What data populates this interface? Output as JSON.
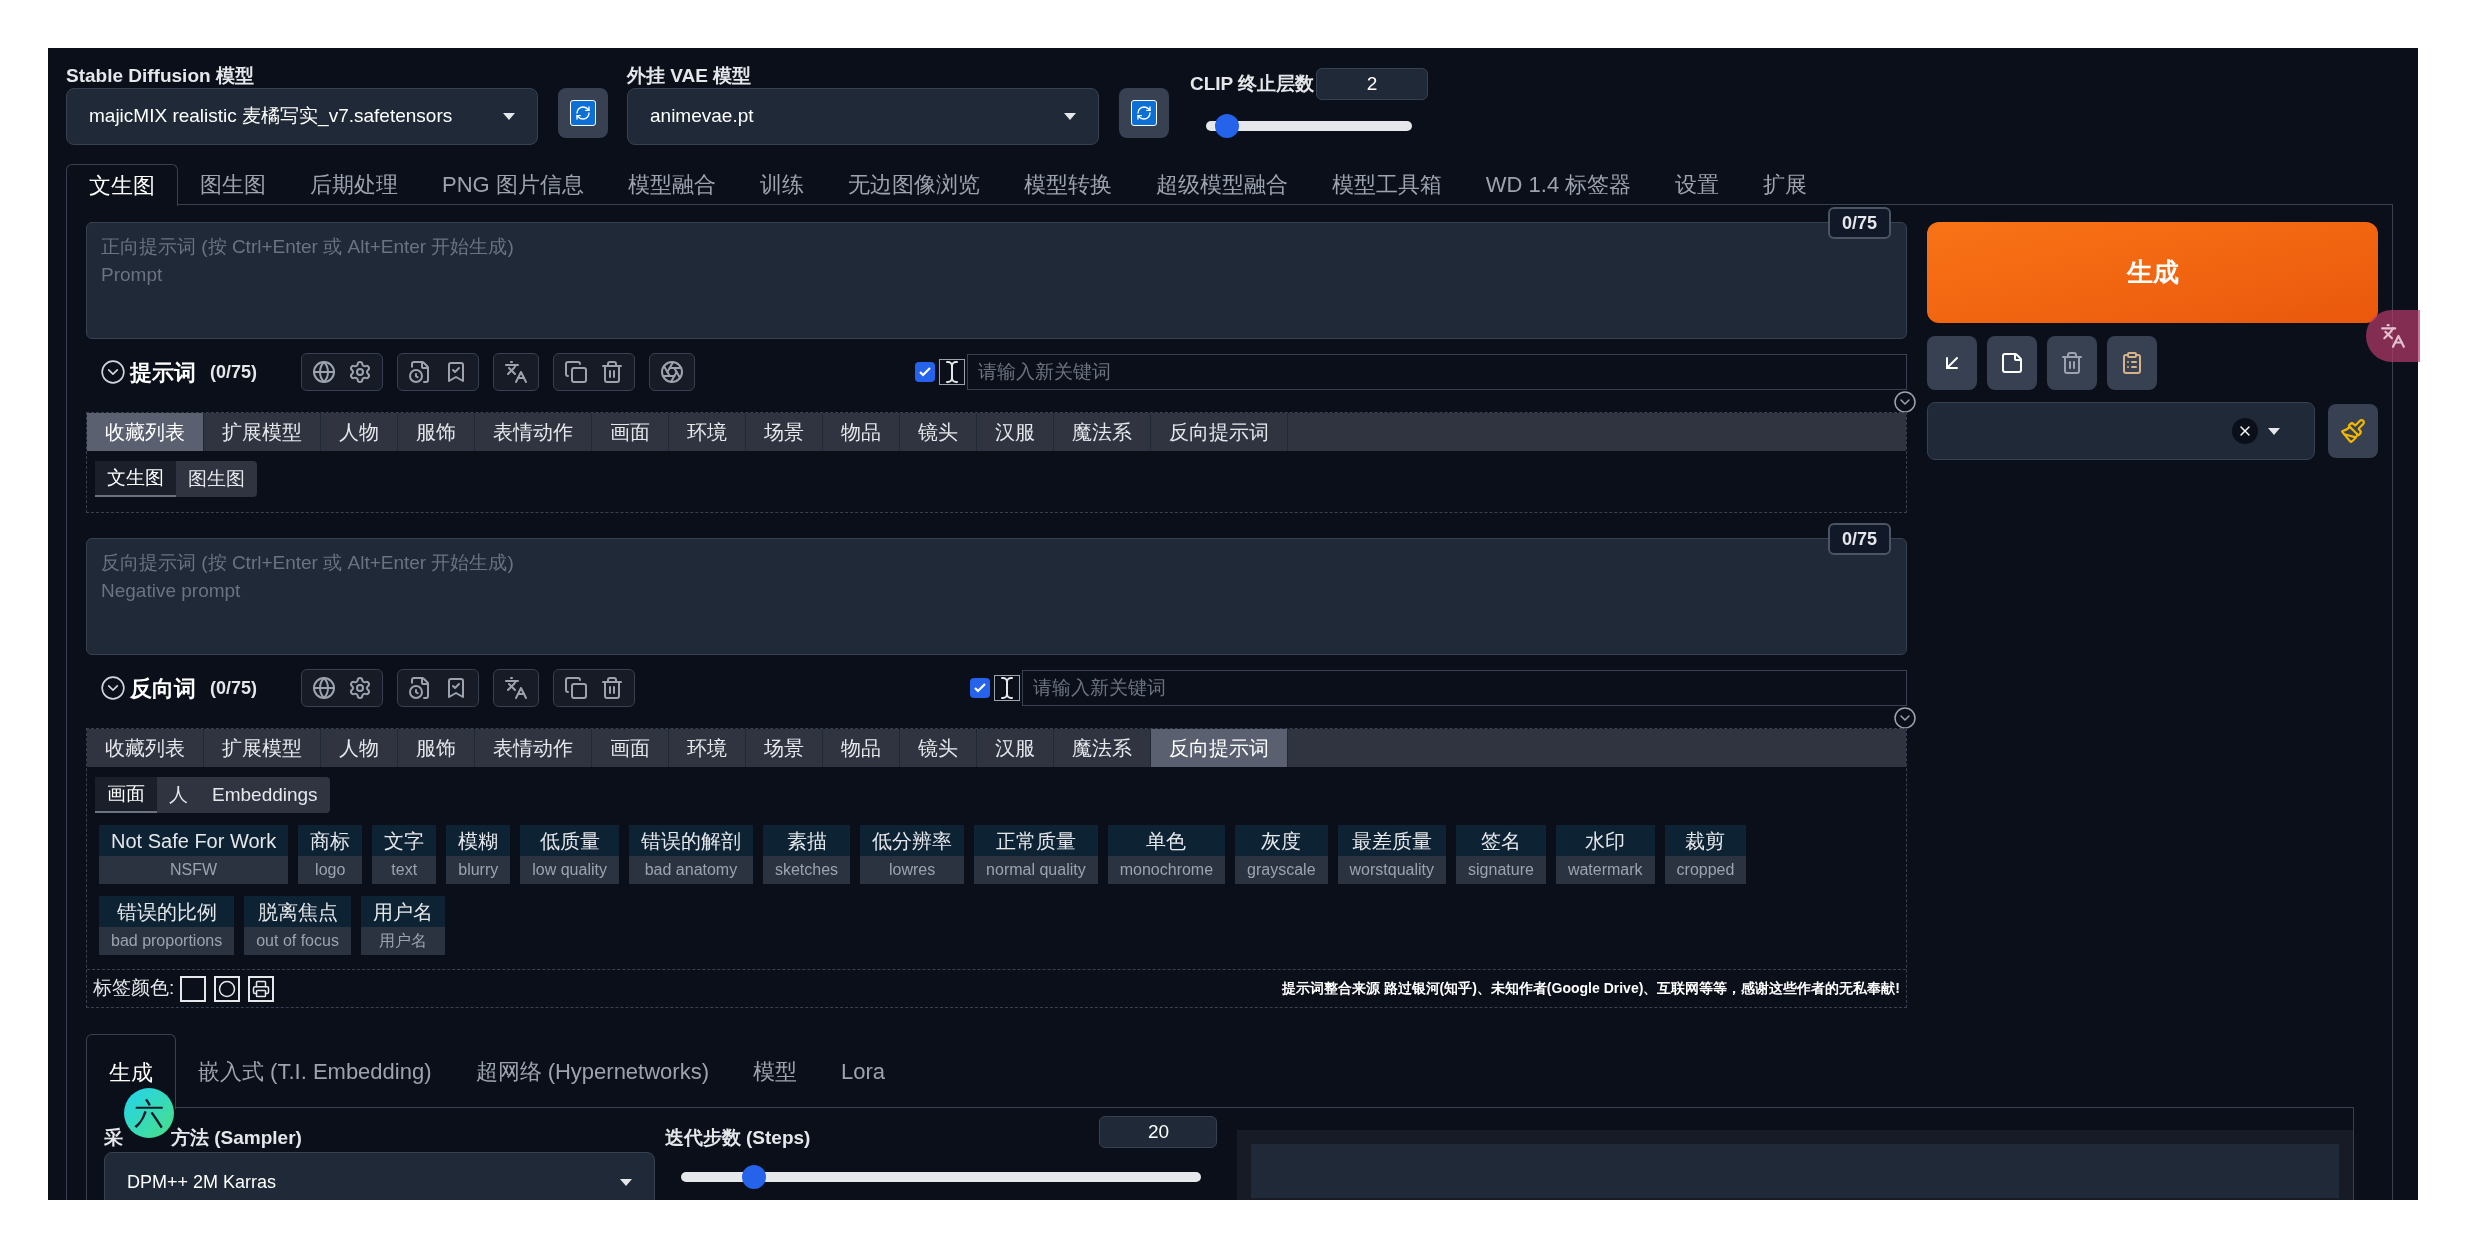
{
  "models": [
    {
      "label": "Stable Diffusion 模型",
      "value": "majicMIX realistic 麦橘写实_v7.safetensors"
    },
    {
      "label": "外挂 VAE 模型",
      "value": "animevae.pt"
    }
  ],
  "clip": {
    "label": "CLIP 终止层数",
    "value": "2",
    "level": 0.1
  },
  "main_tabs": [
    {
      "label": "文生图",
      "selected": true
    },
    {
      "label": "图生图",
      "selected": false
    },
    {
      "label": "后期处理",
      "selected": false
    },
    {
      "label": "PNG 图片信息",
      "selected": false
    },
    {
      "label": "模型融合",
      "selected": false
    },
    {
      "label": "训练",
      "selected": false
    },
    {
      "label": "无边图像浏览",
      "selected": false
    },
    {
      "label": "模型转换",
      "selected": false
    },
    {
      "label": "超级模型融合",
      "selected": false
    },
    {
      "label": "模型工具箱",
      "selected": false
    },
    {
      "label": "WD 1.4 标签器",
      "selected": false
    },
    {
      "label": "设置",
      "selected": false
    },
    {
      "label": "扩展",
      "selected": false
    }
  ],
  "prompts": [
    {
      "counter": "0/75",
      "placeholder": "正向提示词 (按 Ctrl+Enter 或 Alt+Enter 开始生成)\nPrompt",
      "title": "提示词",
      "count": "(0/75)",
      "ai_button": true,
      "keyword_enabled": true,
      "keyword_placeholder": "请输入新关键词",
      "categories": [
        {
          "label": "收藏列表",
          "selected": true
        },
        {
          "label": "扩展模型",
          "selected": false
        },
        {
          "label": "人物",
          "selected": false
        },
        {
          "label": "服饰",
          "selected": false
        },
        {
          "label": "表情动作",
          "selected": false
        },
        {
          "label": "画面",
          "selected": false
        },
        {
          "label": "环境",
          "selected": false
        },
        {
          "label": "场景",
          "selected": false
        },
        {
          "label": "物品",
          "selected": false
        },
        {
          "label": "镜头",
          "selected": false
        },
        {
          "label": "汉服",
          "selected": false
        },
        {
          "label": "魔法系",
          "selected": false
        },
        {
          "label": "反向提示词",
          "selected": false
        }
      ],
      "subtabs": [
        {
          "label": "文生图",
          "selected": true
        },
        {
          "label": "图生图",
          "selected": false
        }
      ]
    },
    {
      "counter": "0/75",
      "placeholder": "反向提示词 (按 Ctrl+Enter 或 Alt+Enter 开始生成)\nNegative prompt",
      "title": "反向词",
      "count": "(0/75)",
      "ai_button": false,
      "keyword_enabled": true,
      "keyword_placeholder": "请输入新关键词",
      "categories": [
        {
          "label": "收藏列表",
          "selected": false
        },
        {
          "label": "扩展模型",
          "selected": false
        },
        {
          "label": "人物",
          "selected": false
        },
        {
          "label": "服饰",
          "selected": false
        },
        {
          "label": "表情动作",
          "selected": false
        },
        {
          "label": "画面",
          "selected": false
        },
        {
          "label": "环境",
          "selected": false
        },
        {
          "label": "场景",
          "selected": false
        },
        {
          "label": "物品",
          "selected": false
        },
        {
          "label": "镜头",
          "selected": false
        },
        {
          "label": "汉服",
          "selected": false
        },
        {
          "label": "魔法系",
          "selected": false
        },
        {
          "label": "反向提示词",
          "selected": true
        }
      ],
      "subtabs": [
        {
          "label": "画面",
          "selected": true
        },
        {
          "label": "人",
          "selected": false
        },
        {
          "label": "Embeddings",
          "selected": false
        }
      ],
      "tags": [
        [
          {
            "name": "Not Safe For Work",
            "sub": "NSFW"
          },
          {
            "name": "商标",
            "sub": "logo"
          },
          {
            "name": "文字",
            "sub": "text"
          },
          {
            "name": "模糊",
            "sub": "blurry"
          },
          {
            "name": "低质量",
            "sub": "low quality"
          },
          {
            "name": "错误的解剖",
            "sub": "bad anatomy"
          },
          {
            "name": "素描",
            "sub": "sketches"
          },
          {
            "name": "低分辨率",
            "sub": "lowres"
          },
          {
            "name": "正常质量",
            "sub": "normal quality"
          },
          {
            "name": "单色",
            "sub": "monochrome"
          },
          {
            "name": "灰度",
            "sub": "grayscale"
          },
          {
            "name": "最差质量",
            "sub": "worstquality"
          },
          {
            "name": "签名",
            "sub": "signature"
          },
          {
            "name": "水印",
            "sub": "watermark"
          },
          {
            "name": "裁剪",
            "sub": "cropped"
          }
        ],
        [
          {
            "name": "错误的比例",
            "sub": "bad proportions"
          },
          {
            "name": "脱离焦点",
            "sub": "out of focus"
          },
          {
            "name": "用户名",
            "sub": "用户名"
          }
        ]
      ],
      "footer": {
        "label": "标签颜色:",
        "credit": "提示词整合来源 路过银河(知乎)、未知作者(Google Drive)、互联网等等，感谢这些作者的无私奉献!"
      }
    }
  ],
  "generate": {
    "label": "生成"
  },
  "bottom_tabs": [
    {
      "label": "生成",
      "selected": true
    },
    {
      "label": "嵌入式 (T.I. Embedding)",
      "selected": false
    },
    {
      "label": "超网络 (Hypernetworks)",
      "selected": false
    },
    {
      "label": "模型",
      "selected": false
    },
    {
      "label": "Lora",
      "selected": false
    }
  ],
  "sampler": {
    "label_parts": [
      "采",
      "方法 (Sampler)"
    ],
    "value": "DPM++ 2M Karras"
  },
  "steps": {
    "label": "迭代步数 (Steps)",
    "value": "20",
    "level": 0.14
  },
  "floating_badge": {
    "label": "六"
  }
}
